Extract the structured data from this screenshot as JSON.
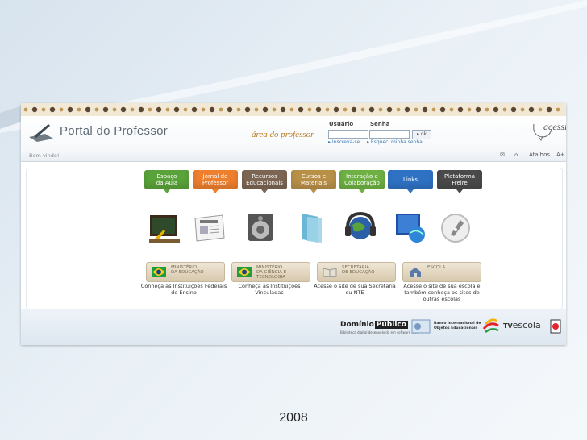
{
  "app": {
    "title": "Portal do Professor",
    "tagline": "área do professor"
  },
  "login": {
    "user_label": "Usuário",
    "pass_label": "Senha",
    "ok_label": "ok",
    "register_link": "Inscreva-se",
    "forgot_link": "Esqueci minha senha"
  },
  "accessibility_label": "acessi",
  "toolbar": {
    "welcome": "Bem-vindo!",
    "shortcuts": "Atalhos",
    "font_plus": "A+"
  },
  "tabs": [
    {
      "label": "Espaço\nda Aula",
      "color": "#5aa23a",
      "icon": "chalkboard-icon"
    },
    {
      "label": "Jornal do\nProfessor",
      "color": "#ee7f2d",
      "icon": "newspaper-icon"
    },
    {
      "label": "Recursos\nEducacionais",
      "color": "#7c6653",
      "icon": "speaker-icon"
    },
    {
      "label": "Cursos e\nMateriais",
      "color": "#b89048",
      "icon": "folders-icon"
    },
    {
      "label": "Interação e\nColaboração",
      "color": "#6eb043",
      "icon": "globe-headset-icon"
    },
    {
      "label": "Links",
      "color": "#2f72c4",
      "icon": "monitor-globe-icon"
    },
    {
      "label": "Plataforma\nFreire",
      "color": "#4a4a4a",
      "icon": "pen-nib-icon"
    }
  ],
  "institutions": [
    {
      "label": "MINISTÉRIO\nDA EDUCAÇÃO",
      "desc": "Conheça as Instituições Federais de Ensino"
    },
    {
      "label": "MINISTÉRIO\nDA CIÊNCIA E\nTECNOLOGIA",
      "desc": "Conheça as Instituições Vinculadas"
    },
    {
      "label": "SECRETARIA\nDE EDUCAÇÃO",
      "desc": "Acesse o site de sua Secretaria ou NTE"
    },
    {
      "label": "ESCOLA",
      "desc": "Acesse o site de sua escola e também conheça os sites de outras escolas"
    }
  ],
  "footer": {
    "dominio": "Domínio",
    "publico": "Público",
    "dominio_sub": "Biblioteca digital desenvolvida em software livre",
    "banco": "Banco Internacional de Objetos Educacionais",
    "tv": "TV",
    "escola": "escola"
  },
  "caption": "2008"
}
